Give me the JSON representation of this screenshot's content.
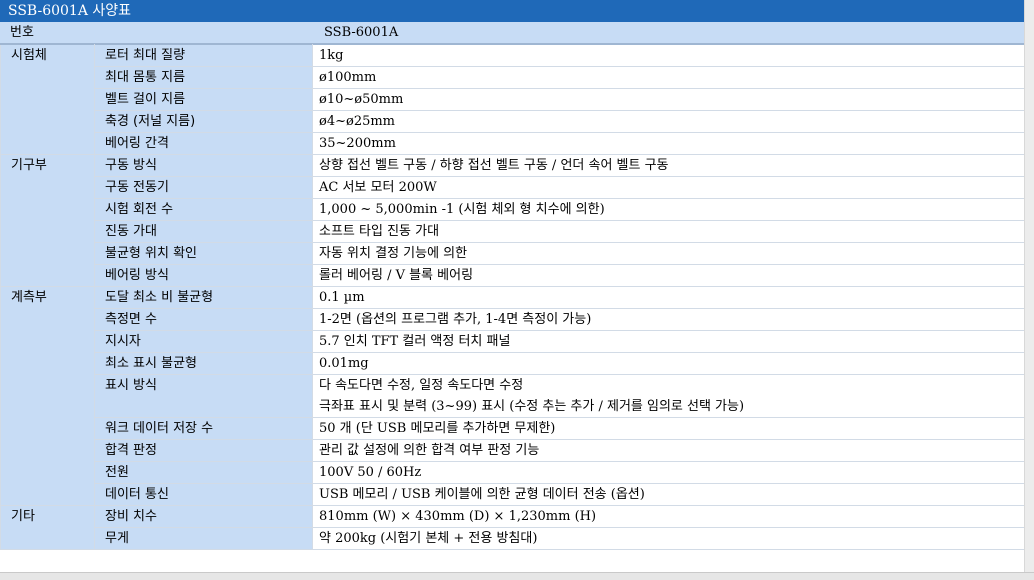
{
  "title": "SSB-6001A 사양표",
  "header": {
    "label": "번호",
    "value": "SSB-6001A"
  },
  "groups": [
    {
      "name": "시험체",
      "rows": [
        {
          "item": "로터 최대 질량",
          "lines": [
            "1kg"
          ]
        },
        {
          "item": "최대 몸통 지름",
          "lines": [
            "ø100mm"
          ]
        },
        {
          "item": "벨트 걸이 지름",
          "lines": [
            "ø10~ø50mm"
          ]
        },
        {
          "item": "축경 (저널 지름)",
          "lines": [
            "ø4~ø25mm"
          ]
        },
        {
          "item": "베어링 간격",
          "lines": [
            "35~200mm"
          ]
        }
      ]
    },
    {
      "name": "기구부",
      "rows": [
        {
          "item": "구동 방식",
          "lines": [
            "상향 접선 벨트 구동 / 하향 접선 벨트 구동 / 언더 속어 벨트 구동"
          ]
        },
        {
          "item": "구동 전동기",
          "lines": [
            "AC 서보 모터 200W"
          ]
        },
        {
          "item": "시험 회전 수",
          "lines": [
            "1,000 ~ 5,000min -1 (시험 체외 형 치수에 의한)"
          ]
        },
        {
          "item": "진동 가대",
          "lines": [
            "소프트 타입 진동 가대"
          ]
        },
        {
          "item": "불균형 위치 확인",
          "lines": [
            "자동 위치 결정 기능에 의한"
          ]
        },
        {
          "item": "베어링 방식",
          "lines": [
            "롤러 베어링 / V 블록 베어링"
          ]
        }
      ]
    },
    {
      "name": "계측부",
      "rows": [
        {
          "item": "도달 최소 비 불균형",
          "lines": [
            "0.1 µm"
          ]
        },
        {
          "item": "측정면 수",
          "lines": [
            "1-2면 (옵션의 프로그램 추가, 1-4면 측정이 가능)"
          ]
        },
        {
          "item": "지시자",
          "lines": [
            "5.7 인치 TFT 컬러 액정 터치 패널"
          ]
        },
        {
          "item": "최소 표시 불균형",
          "lines": [
            "0.01mg"
          ]
        },
        {
          "item": "표시 방식",
          "lines": [
            "다 속도다면 수정, 일정 속도다면 수정",
            "극좌표 표시 및 분력 (3~99) 표시 (수정 추는 추가 / 제거를 임의로 선택 가능)"
          ]
        },
        {
          "item": "워크 데이터 저장 수",
          "lines": [
            "50 개 (단 USB 메모리를 추가하면 무제한)"
          ]
        },
        {
          "item": "합격 판정",
          "lines": [
            "관리 값 설정에 의한 합격 여부 판정 기능"
          ]
        },
        {
          "item": "전원",
          "lines": [
            "100V 50 / 60Hz"
          ]
        },
        {
          "item": "데이터 통신",
          "lines": [
            "USB 메모리 / USB 케이블에 의한 균형 데이터 전송 (옵션)"
          ]
        }
      ]
    },
    {
      "name": "기타",
      "rows": [
        {
          "item": "장비 치수",
          "lines": [
            "810mm (W) × 430mm (D) × 1,230mm (H)"
          ]
        },
        {
          "item": "무게",
          "lines": [
            "약 200kg (시험기 본체 + 전용 방침대)"
          ]
        }
      ]
    }
  ],
  "colors": {
    "title_bg": "#1f69b8",
    "label_bg": "#c7dcf5",
    "value_bg": "#ffffff"
  }
}
